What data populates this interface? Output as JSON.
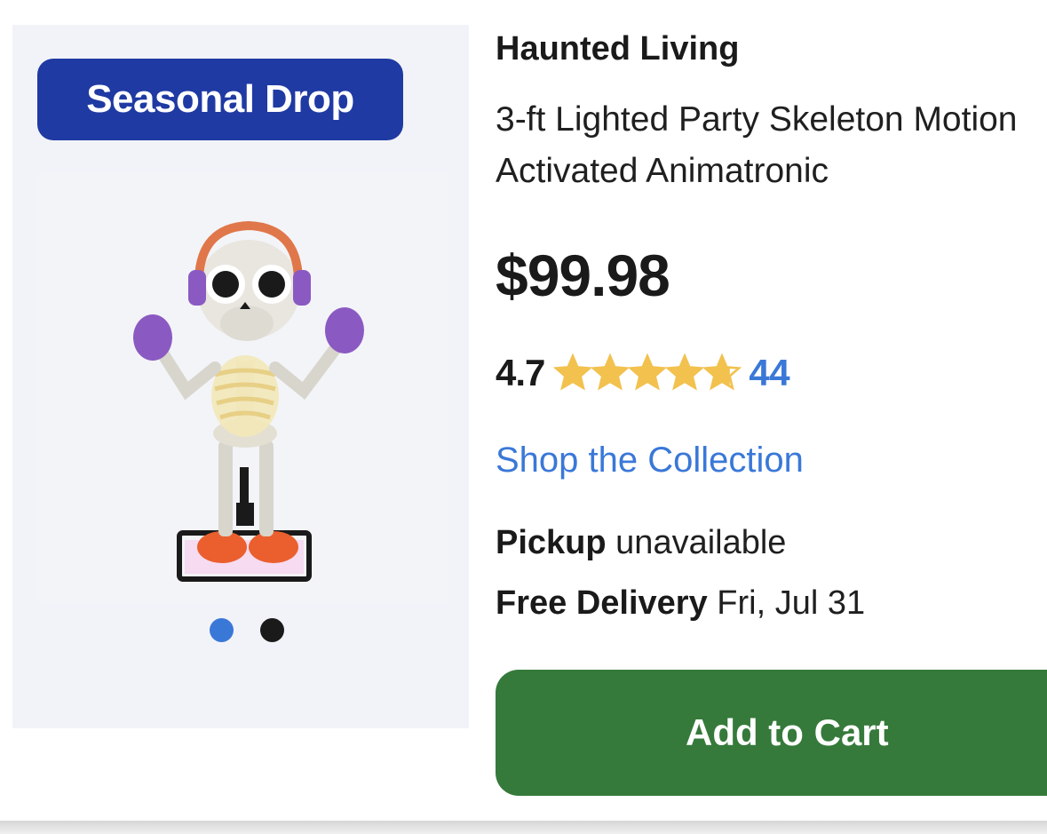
{
  "badge": {
    "label": "Seasonal Drop",
    "color": "#1f3aa3"
  },
  "image": {
    "alt": "skeleton-animatronic-icon"
  },
  "carousel": {
    "count": 2,
    "active_index": 0,
    "active_color": "#3a78d8"
  },
  "product": {
    "brand": "Haunted Living",
    "title_line1": "3-ft Lighted Party Skeleton Motion",
    "title_line2": "Activated Animatronic",
    "price": "$99.98",
    "rating": "4.7",
    "rating_value": 4.7,
    "rating_max": 5,
    "review_count": "44",
    "star_color": "#f2c14e"
  },
  "links": {
    "collection": "Shop the Collection"
  },
  "fulfillment": {
    "pickup_label": "Pickup",
    "pickup_status": "unavailable",
    "delivery_label": "Free Delivery",
    "delivery_date": "Fri, Jul 31"
  },
  "actions": {
    "add_to_cart": "Add to Cart",
    "button_color": "#357a3a"
  }
}
